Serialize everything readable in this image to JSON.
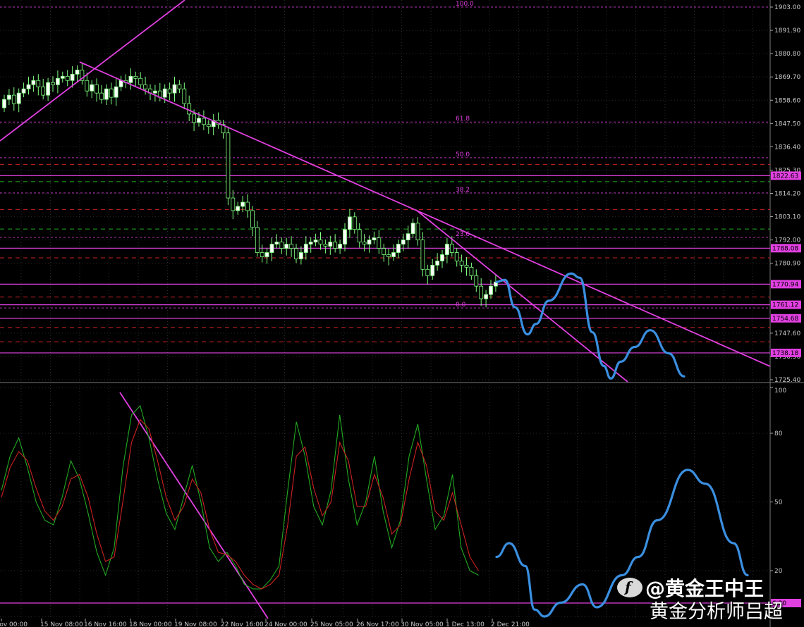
{
  "colors": {
    "background": "#000000",
    "grid": "#2a2a2a",
    "axis_text": "#c8c8c8",
    "candle_bull": "#ffffff",
    "candle_bear": "#000000",
    "candle_wick": "#7fff7f",
    "trendline": "#e040e0",
    "level_line": "#e040e0",
    "fib_dashed_red": "#cc2222",
    "fib_dashed_green": "#22aa22",
    "projection": "#3a8fe0",
    "stoch_main": "#22aa22",
    "stoch_signal": "#cc2222",
    "level_label_bg": "#e040e0",
    "level_label_text": "#000000"
  },
  "chart_data": [
    {
      "type": "candlestick",
      "panel": "price",
      "ylim": [
        1725.4,
        1903.0
      ],
      "yticks": [
        "1903.00",
        "1891.90",
        "1880.80",
        "1869.70",
        "1858.60",
        "1847.50",
        "1836.40",
        "1825.30",
        "1814.20",
        "1803.10",
        "1792.00",
        "1780.90",
        "1747.60",
        "1736.50",
        "1725.40"
      ],
      "xticks": [
        "2 Nov 00:00",
        "15 Nov 08:00",
        "16 Nov 16:00",
        "18 Nov 00:00",
        "19 Nov 08:00",
        "22 Nov 16:00",
        "24 Nov 00:00",
        "25 Nov 05:00",
        "26 Nov 17:00",
        "30 Nov 05:00",
        "1 Dec 13:00",
        "2 Dec 21:00"
      ],
      "fib_levels": [
        {
          "label": "100.0",
          "value": 1903.0
        },
        {
          "label": "61.8",
          "value": 1848.2
        },
        {
          "label": "50.0",
          "value": 1831.2
        },
        {
          "label": "38.2",
          "value": 1814.4
        },
        {
          "label": "23.6",
          "value": 1793.2
        },
        {
          "label": "0.0",
          "value": 1759.6
        }
      ],
      "price_levels": [
        "1822.63",
        "1788.08",
        "1770.94",
        "1761.12",
        "1754.68",
        "1738.18"
      ],
      "candles_close": [
        1859,
        1861,
        1857,
        1862,
        1864,
        1866,
        1868,
        1865,
        1861,
        1867,
        1866,
        1869,
        1870,
        1868,
        1871,
        1873,
        1868,
        1863,
        1866,
        1862,
        1859,
        1864,
        1860,
        1865,
        1868,
        1867,
        1870,
        1869,
        1866,
        1864,
        1862,
        1863,
        1860,
        1864,
        1862,
        1866,
        1864,
        1857,
        1852,
        1848,
        1850,
        1847,
        1846,
        1849,
        1847,
        1843,
        1812,
        1806,
        1808,
        1810,
        1806,
        1798,
        1786,
        1784,
        1786,
        1790,
        1791,
        1788,
        1790,
        1788,
        1783,
        1786,
        1790,
        1791,
        1792,
        1790,
        1789,
        1791,
        1788,
        1790,
        1797,
        1803,
        1797,
        1791,
        1790,
        1792,
        1793,
        1788,
        1785,
        1784,
        1786,
        1790,
        1792,
        1795,
        1800,
        1792,
        1778,
        1775,
        1780,
        1782,
        1785,
        1790,
        1786,
        1782,
        1780,
        1779,
        1775,
        1770,
        1764,
        1766,
        1770,
        1772
      ],
      "projection_path": [
        1772,
        1773,
        1760,
        1747,
        1752,
        1763,
        1776,
        1774,
        1748,
        1732,
        1726,
        1734,
        1741,
        1749,
        1738,
        1727
      ]
    },
    {
      "type": "line",
      "panel": "stochastic",
      "ylim": [
        0,
        100
      ],
      "yticks": [
        "100",
        "80",
        "50",
        "20",
        "0"
      ],
      "level_label": "6.20",
      "series": [
        {
          "values": [
            55,
            70,
            78,
            65,
            50,
            42,
            40,
            52,
            68,
            60,
            45,
            28,
            18,
            30,
            65,
            88,
            92,
            78,
            60,
            45,
            38,
            52,
            66,
            50,
            30,
            24,
            28,
            22,
            14,
            12,
            12,
            16,
            22,
            55,
            85,
            70,
            48,
            40,
            55,
            88,
            60,
            40,
            50,
            70,
            46,
            30,
            42,
            70,
            84,
            60,
            38,
            44,
            62,
            30,
            20,
            18
          ]
        },
        {
          "values": [
            52,
            65,
            72,
            68,
            56,
            46,
            42,
            48,
            60,
            62,
            52,
            36,
            24,
            26,
            50,
            76,
            86,
            82,
            68,
            52,
            42,
            48,
            60,
            54,
            38,
            28,
            27,
            24,
            18,
            14,
            12,
            14,
            18,
            40,
            70,
            74,
            56,
            44,
            50,
            76,
            68,
            48,
            48,
            62,
            52,
            36,
            40,
            60,
            76,
            66,
            46,
            42,
            54,
            40,
            26,
            20
          ]
        }
      ],
      "projection_path": [
        26,
        32,
        22,
        3,
        0,
        6,
        14,
        4,
        18,
        26,
        42,
        64,
        58,
        32,
        18
      ]
    }
  ],
  "watermark": {
    "logo_letter": "f",
    "line1": "@黄金王中王",
    "line2": "黄金分析师吕超"
  }
}
